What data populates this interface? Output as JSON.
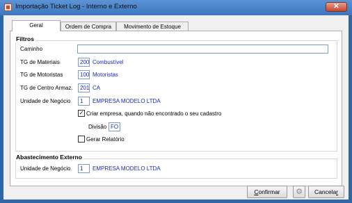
{
  "window": {
    "title": "Importação Ticket Log - Interno e Externo",
    "close_label": "✕"
  },
  "tabs": [
    {
      "label": "Geral"
    },
    {
      "label": "Ordem de Compra"
    },
    {
      "label": "Movimento de Estoque"
    }
  ],
  "filtros": {
    "title": "Filtros",
    "caminho": {
      "label": "Caminho",
      "value": ""
    },
    "tg_materiais": {
      "label": "TG de Materiais",
      "code": "200",
      "desc": "Combustível"
    },
    "tg_motoristas": {
      "label": "TG de Motoristas",
      "code": "100",
      "desc": "Motoristas"
    },
    "tg_centro": {
      "label": "TG de Centro Armaz.",
      "code": "201",
      "desc": "CA"
    },
    "unidade": {
      "label": "Unidade de Negócio",
      "code": "1",
      "desc": "EMPRESA MODELO LTDA"
    },
    "criar_empresa": {
      "label": "Criar empresa, quando não encontrado o seu cadastro",
      "checked": "✓"
    },
    "divisao": {
      "label": "Divisão",
      "value": "FO"
    },
    "gerar_relatorio": {
      "label": "Gerar Relatório",
      "checked": ""
    }
  },
  "abastecimento": {
    "title": "Abastecimento Externo",
    "unidade": {
      "label": "Unidade de Negócio",
      "code": "1",
      "desc": "EMPRESA MODELO LTDA"
    }
  },
  "buttons": {
    "confirmar_prefix": "C",
    "confirmar_rest": "onfirmar",
    "gear": "⚙",
    "cancelar_prefix": "Cancela",
    "cancelar_u": "r"
  }
}
